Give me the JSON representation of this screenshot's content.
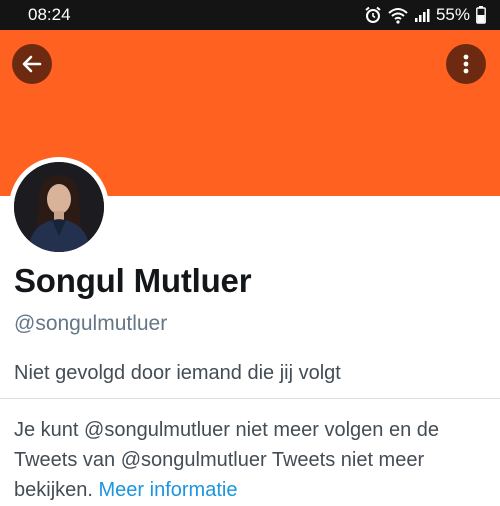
{
  "status_bar": {
    "time": "08:24",
    "icons": [
      "alarm-icon",
      "wifi-icon",
      "signal-icon"
    ],
    "battery_percent": "55%",
    "battery_icon": "battery-icon"
  },
  "header": {
    "banner_color": "#ff6121",
    "back_icon": "arrow-left-icon",
    "more_icon": "more-vertical-icon"
  },
  "profile": {
    "name": "Songul Mutluer",
    "handle": "@songulmutluer",
    "follow_context": "Niet gevolgd door iemand die jij volgt"
  },
  "notice": {
    "text": "Je kunt @songulmutluer niet meer volgen en de Tweets van @songulmutluer Tweets niet meer bekijken. ",
    "link_text": "Meer informatie",
    "link_color": "#1b95e0"
  }
}
